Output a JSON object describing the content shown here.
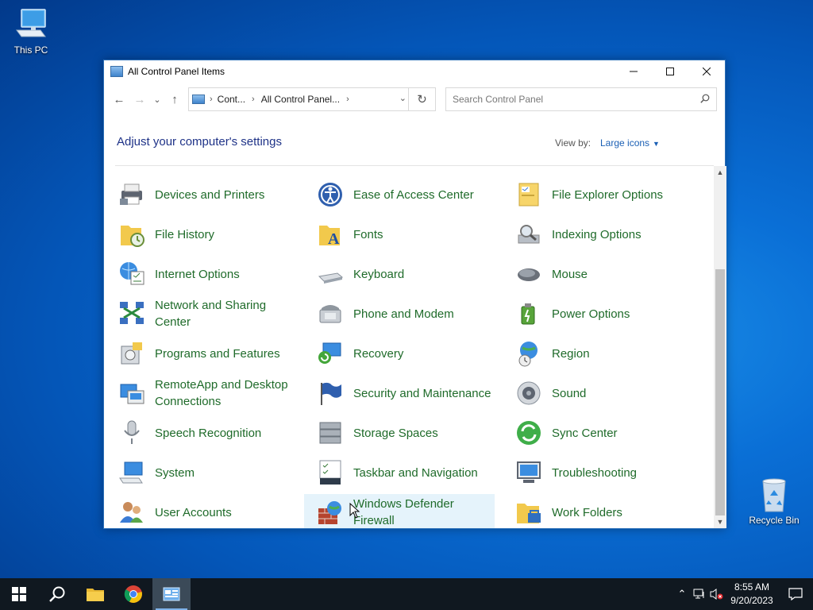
{
  "desktop": {
    "this_pc_label": "This PC",
    "recycle_bin_label": "Recycle Bin"
  },
  "window": {
    "title": "All Control Panel Items",
    "controls": {
      "minimize": "—",
      "maximize": "☐",
      "close": "✕"
    },
    "nav": {
      "back": "←",
      "forward": "→",
      "recent": "⌄",
      "up": "↑"
    },
    "address": {
      "crumb1": "Cont...",
      "crumb2": "All Control Panel...",
      "sep": "›",
      "dropdown": "⌄",
      "refresh": "↻"
    },
    "search": {
      "placeholder": "Search Control Panel"
    },
    "heading": "Adjust your computer's settings",
    "viewby_label": "View by:",
    "viewby_value": "Large icons",
    "items": [
      {
        "label": "Devices and Printers",
        "icon": "printer-icon"
      },
      {
        "label": "Ease of Access Center",
        "icon": "ease-of-access-icon"
      },
      {
        "label": "File Explorer Options",
        "icon": "folder-options-icon"
      },
      {
        "label": "File History",
        "icon": "file-history-icon"
      },
      {
        "label": "Fonts",
        "icon": "fonts-icon"
      },
      {
        "label": "Indexing Options",
        "icon": "indexing-icon"
      },
      {
        "label": "Internet Options",
        "icon": "internet-options-icon"
      },
      {
        "label": "Keyboard",
        "icon": "keyboard-icon"
      },
      {
        "label": "Mouse",
        "icon": "mouse-icon"
      },
      {
        "label": "Network and Sharing Center",
        "icon": "network-icon"
      },
      {
        "label": "Phone and Modem",
        "icon": "phone-icon"
      },
      {
        "label": "Power Options",
        "icon": "power-icon"
      },
      {
        "label": "Programs and Features",
        "icon": "programs-icon"
      },
      {
        "label": "Recovery",
        "icon": "recovery-icon"
      },
      {
        "label": "Region",
        "icon": "region-icon"
      },
      {
        "label": "RemoteApp and Desktop Connections",
        "icon": "remoteapp-icon"
      },
      {
        "label": "Security and Maintenance",
        "icon": "security-flag-icon"
      },
      {
        "label": "Sound",
        "icon": "speaker-icon"
      },
      {
        "label": "Speech Recognition",
        "icon": "microphone-icon"
      },
      {
        "label": "Storage Spaces",
        "icon": "storage-icon"
      },
      {
        "label": "Sync Center",
        "icon": "sync-icon"
      },
      {
        "label": "System",
        "icon": "system-icon"
      },
      {
        "label": "Taskbar and Navigation",
        "icon": "taskbar-icon"
      },
      {
        "label": "Troubleshooting",
        "icon": "troubleshooting-icon"
      },
      {
        "label": "User Accounts",
        "icon": "users-icon"
      },
      {
        "label": "Windows Defender Firewall",
        "icon": "firewall-icon"
      },
      {
        "label": "Work Folders",
        "icon": "work-folders-icon"
      }
    ]
  },
  "taskbar": {
    "tray_chevron": "⌃",
    "time": "8:55 AM",
    "date": "9/20/2023"
  },
  "colors": {
    "item_text": "#1f6b2a",
    "heading": "#1e3287",
    "link": "#1a5fb4",
    "taskbar": "#101820"
  }
}
